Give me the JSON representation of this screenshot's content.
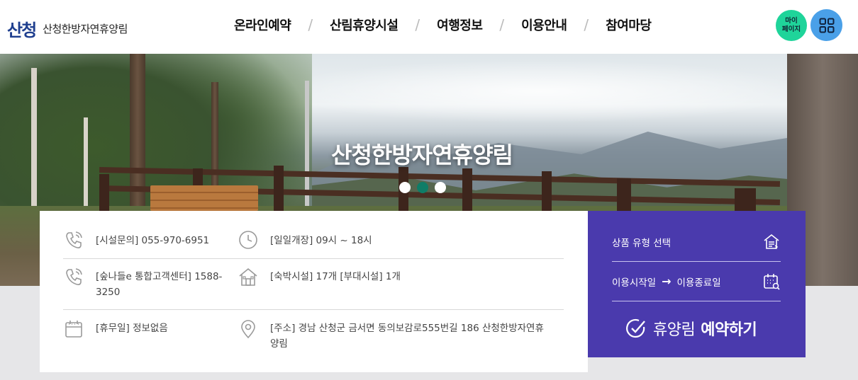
{
  "header": {
    "logo_mark": "산청",
    "logo_mark_small": "청",
    "site_name": "산청한방자연휴양림",
    "nav": [
      {
        "label": "온라인예약"
      },
      {
        "label": "산림휴양시설"
      },
      {
        "label": "여행정보"
      },
      {
        "label": "이용안내"
      },
      {
        "label": "참여마당"
      }
    ],
    "nav_separator": "/",
    "mypage_line1": "마이",
    "mypage_line2": "페이지",
    "menu_icon": "grid-menu-icon"
  },
  "hero": {
    "title": "산청한방자연휴양림",
    "slides_count": 3,
    "active_slide": 2
  },
  "info": {
    "facility_phone": "[시설문의] 055-970-6951",
    "hours": "[일일개장] 09시 ~ 18시",
    "call_center": "[숲나들e 통합고객센터] 1588-3250",
    "accommodation": "[숙박시설] 17개 [부대시설] 1개",
    "closed_day": "[휴무일] 정보없음",
    "address": "[주소] 경남 산청군 금서면 동의보감로555번길 186 산청한방자연휴양림"
  },
  "booking": {
    "product_type": "상품 유형 선택",
    "start_date": "이용시작일",
    "arrow": "→",
    "end_date": "이용종료일",
    "cta_prefix": "휴양림",
    "cta_bold": "예약하기"
  },
  "colors": {
    "booking_bg": "#4a3aad",
    "mypage_bg": "#1fd49a",
    "menu_bg": "#4aa0e8",
    "active_dot": "#0f7d67"
  }
}
